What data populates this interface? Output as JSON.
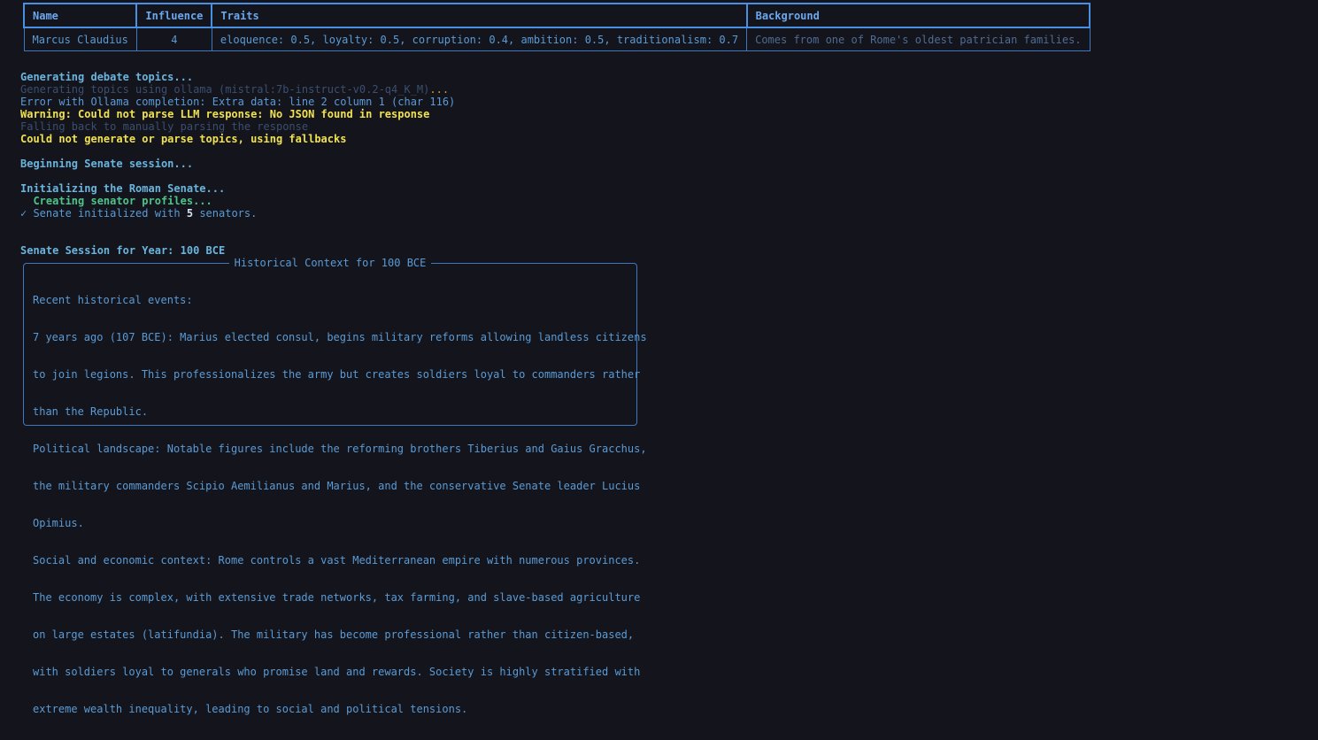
{
  "table": {
    "headers": {
      "name": "Name",
      "influence": "Influence",
      "traits": "Traits",
      "background": "Background"
    },
    "rows": [
      {
        "name": "Marcus Claudius",
        "influence": "4",
        "traits": "eloquence: 0.5, loyalty: 0.5, corruption: 0.4, ambition: 0.5, traditionalism: 0.7",
        "background": "Comes from one of Rome's oldest patrician families."
      }
    ]
  },
  "log": {
    "generating_topics": "Generating debate topics...",
    "ollama_prefix": "Generating topics using ollama (mistral:7b-instruct-v0.2-q4_K_M)",
    "ollama_dots": "...",
    "ollama_error": "Error with Ollama completion: Extra data: line 2 column 1 (char 116)",
    "warning": "Warning: Could not parse LLM response: No JSON found in response",
    "fallback_manual": "Falling back to manually parsing the response",
    "fallback_topics": "Could not generate or parse topics, using fallbacks",
    "beginning_session": "Beginning Senate session...",
    "initializing": "Initializing the Roman Senate...",
    "creating_profiles": "  Creating senator profiles...",
    "check_mark": "✓",
    "initialized_prefix": " Senate initialized with ",
    "senator_count": "5",
    "initialized_suffix": " senators.",
    "session_year": "Senate Session for Year: 100 BCE"
  },
  "context_panel": {
    "title": "Historical Context for 100 BCE",
    "lines": [
      "Recent historical events:",
      "7 years ago (107 BCE): Marius elected consul, begins military reforms allowing landless citizens",
      "to join legions. This professionalizes the army but creates soldiers loyal to commanders rather",
      "than the Republic.",
      "Political landscape: Notable figures include the reforming brothers Tiberius and Gaius Gracchus,",
      "the military commanders Scipio Aemilianus and Marius, and the conservative Senate leader Lucius",
      "Opimius.",
      "Social and economic context: Rome controls a vast Mediterranean empire with numerous provinces.",
      "The economy is complex, with extensive trade networks, tax farming, and slave-based agriculture",
      "on large estates (latifundia). The military has become professional rather than citizen-based,",
      "with soldiers loyal to generals who promise land and rewards. Society is highly stratified with",
      "extreme wealth inequality, leading to social and political tensions."
    ]
  },
  "colors": {
    "background": "#13141c",
    "accent_blue": "#4a90e2",
    "warning_yellow": "#f0e150",
    "success_green": "#4fc38a"
  }
}
